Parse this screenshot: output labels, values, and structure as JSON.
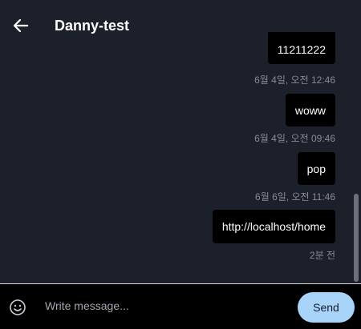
{
  "header": {
    "title": "Danny-test"
  },
  "messages": [
    {
      "text": "11211222",
      "time": "6월 4일, 오전 12:46"
    },
    {
      "text": "woww",
      "time": "6월 4일, 오전 09:46"
    },
    {
      "text": "pop",
      "time": "6월 6일, 오전 11:46"
    },
    {
      "text": "http://localhost/home",
      "time": "2분 전"
    }
  ],
  "composer": {
    "placeholder": "Write message...",
    "value": "",
    "send_label": "Send"
  },
  "icons": {
    "back": "arrow-left-icon",
    "emoji": "smiley-icon"
  },
  "colors": {
    "background": "#1c202b",
    "bubble": "#000000",
    "send_button": "#a8d4fa",
    "timestamp": "#868b98"
  }
}
